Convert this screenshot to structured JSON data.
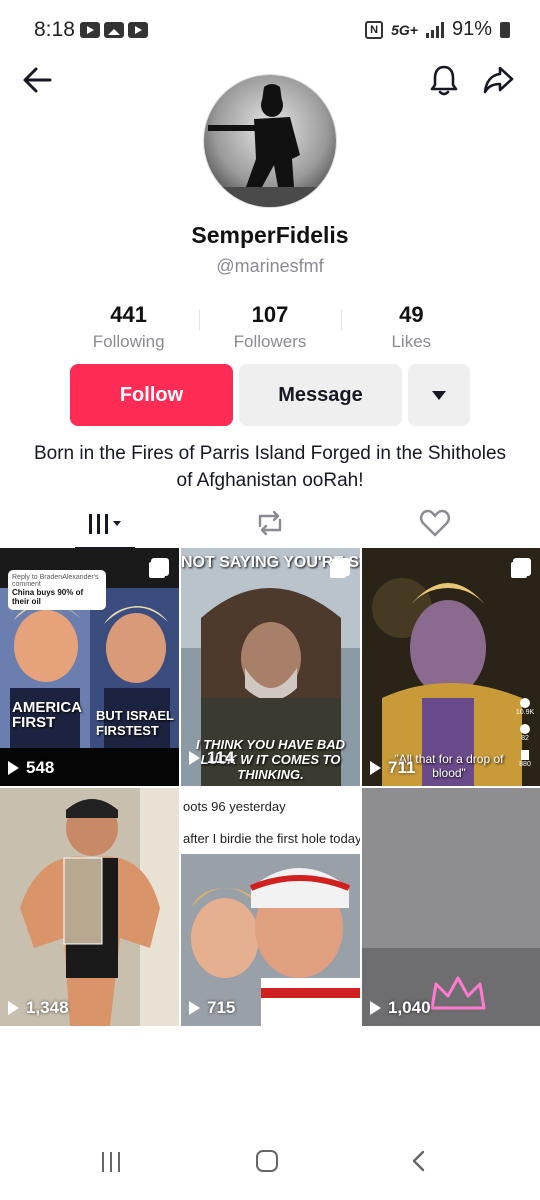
{
  "status_bar": {
    "time": "8:18",
    "network": "5G+",
    "battery": "91%"
  },
  "profile": {
    "display_name": "SemperFidelis",
    "handle": "@marinesfmf",
    "bio": "Born in the Fires of Parris Island Forged in the Shitholes of Afghanistan ooRah!"
  },
  "stats": [
    {
      "value": "441",
      "label": "Following"
    },
    {
      "value": "107",
      "label": "Followers"
    },
    {
      "value": "49",
      "label": "Likes"
    }
  ],
  "actions": {
    "follow_label": "Follow",
    "message_label": "Message"
  },
  "tabs": [
    {
      "name": "videos",
      "icon": "grid-icon"
    },
    {
      "name": "reposts",
      "icon": "repost-icon"
    },
    {
      "name": "liked",
      "icon": "heart-icon"
    }
  ],
  "videos": [
    {
      "views": "548",
      "reply_header": "Reply to BradenAlexander's comment",
      "reply_text": "China buys 90% of their oil",
      "left_banner": "AMERICA FIRST",
      "right_banner": "BUT ISRAEL FIRSTEST"
    },
    {
      "views": "114",
      "top_caption": "NOT SAYING YOU'RE STUPI",
      "bottom_caption": "I THINK YOU HAVE BAD LUCK W IT COMES TO THINKING."
    },
    {
      "views": "711",
      "side_caption": "\"All that for a drop of blood\"",
      "like_count": "10.9K",
      "comment_count": "82",
      "save_count": "880"
    },
    {
      "views": "1,348"
    },
    {
      "views": "715",
      "caption_line1": "oots 96 yesterday",
      "caption_line2": "after I birdie the first hole today"
    },
    {
      "views": "1,040"
    }
  ],
  "colors": {
    "follow": "#fe2c55",
    "button_gray": "#efefef",
    "muted_text": "#8a8b91"
  }
}
